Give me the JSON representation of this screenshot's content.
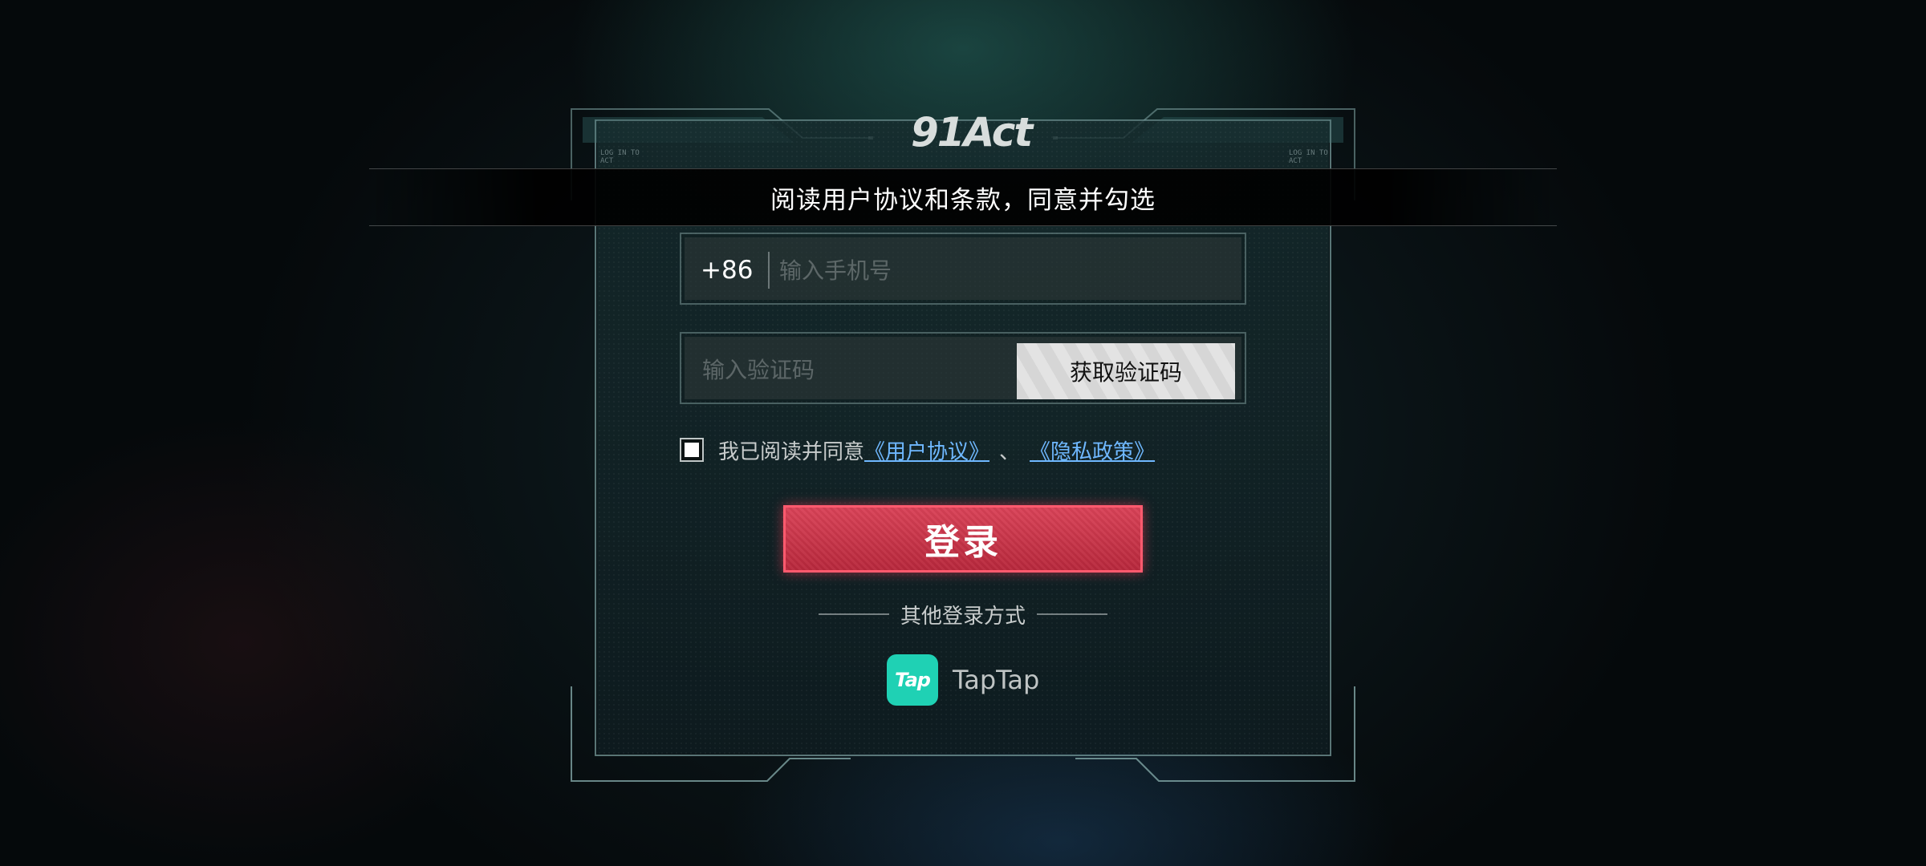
{
  "logo": {
    "text": "91Act"
  },
  "corner_tags": {
    "left": "LOG IN TO\nACT",
    "right": "LOG IN TO\nACT"
  },
  "toast": {
    "message": "阅读用户协议和条款，同意并勾选"
  },
  "phone": {
    "prefix": "+86",
    "placeholder": "输入手机号",
    "value": ""
  },
  "code": {
    "placeholder": "输入验证码",
    "value": "",
    "get_code_label": "获取验证码"
  },
  "agreement": {
    "checked": false,
    "text": "我已阅读并同意",
    "user_agreement": "《用户协议》",
    "separator": "、",
    "privacy_policy": "《隐私政策》"
  },
  "login": {
    "label": "登录"
  },
  "other_login": {
    "label": "其他登录方式"
  },
  "taptap": {
    "icon_text": "Tap",
    "label": "TapTap"
  },
  "colors": {
    "accent_red": "#c8334a",
    "link_blue": "#6fb8ff",
    "taptap_teal": "#1fd1b4"
  }
}
